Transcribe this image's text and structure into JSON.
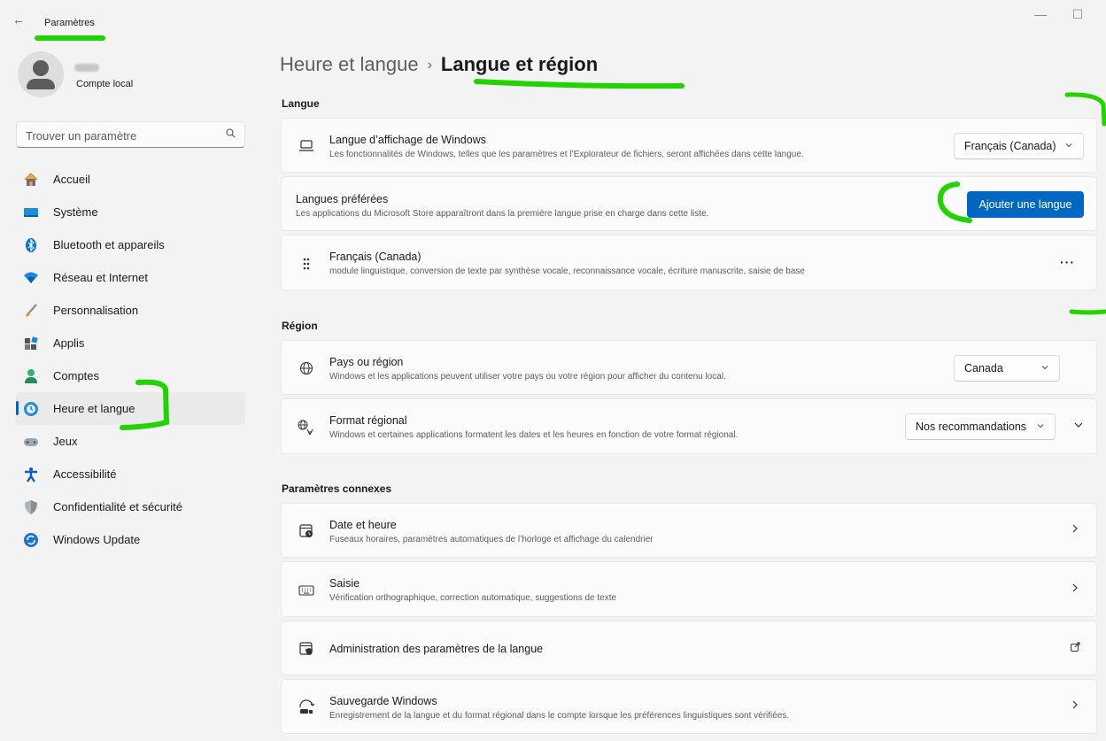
{
  "window": {
    "title": "Paramètres",
    "back_icon": "←",
    "minimize_icon": "—",
    "maximize_icon": "☐"
  },
  "profile": {
    "account_type": "Compte local"
  },
  "search": {
    "placeholder": "Trouver un paramètre"
  },
  "nav": {
    "items": [
      {
        "label": "Accueil",
        "icon": "home-icon"
      },
      {
        "label": "Système",
        "icon": "system-icon"
      },
      {
        "label": "Bluetooth et appareils",
        "icon": "bluetooth-icon"
      },
      {
        "label": "Réseau et Internet",
        "icon": "network-icon"
      },
      {
        "label": "Personnalisation",
        "icon": "brush-icon"
      },
      {
        "label": "Applis",
        "icon": "apps-icon"
      },
      {
        "label": "Comptes",
        "icon": "accounts-icon"
      },
      {
        "label": "Heure et langue",
        "icon": "time-language-icon",
        "selected": true
      },
      {
        "label": "Jeux",
        "icon": "gamepad-icon"
      },
      {
        "label": "Accessibilité",
        "icon": "accessibility-icon"
      },
      {
        "label": "Confidentialité et sécurité",
        "icon": "shield-icon"
      },
      {
        "label": "Windows Update",
        "icon": "update-icon"
      }
    ]
  },
  "breadcrumb": {
    "parent": "Heure et langue",
    "separator": "›",
    "current": "Langue et région"
  },
  "sections": {
    "langue": "Langue",
    "region": "Région",
    "related": "Paramètres connexes"
  },
  "display_language": {
    "title": "Langue d’affichage de Windows",
    "description": "Les fonctionnalités de Windows, telles que les paramètres et l’Explorateur de fichiers, seront affichées dans cette langue.",
    "value": "Français (Canada)"
  },
  "preferred_languages": {
    "title": "Langues préférées",
    "description": "Les applications du Microsoft Store apparaîtront dans la première langue prise en charge dans cette liste.",
    "button": "Ajouter une langue"
  },
  "installed_language": {
    "title": "Français (Canada)",
    "description": "module linguistique, conversion de texte par synthèse vocale, reconnaissance vocale, écriture manuscrite, saisie de base",
    "more": "···"
  },
  "country_region": {
    "title": "Pays ou région",
    "description": "Windows et les applications peuvent utiliser votre pays ou votre région pour afficher du contenu local.",
    "value": "Canada"
  },
  "regional_format": {
    "title": "Format régional",
    "description": "Windows et certaines applications formatent les dates et les heures en fonction de votre format régional.",
    "value": "Nos recommandations"
  },
  "related": [
    {
      "title": "Date et heure",
      "description": "Fuseaux horaires, paramètres automatiques de l’horloge et affichage du calendrier",
      "icon": "calendar-clock-icon"
    },
    {
      "title": "Saisie",
      "description": "Vérification orthographique, correction automatique, suggestions de texte",
      "icon": "keyboard-icon"
    },
    {
      "title": "Administration des paramètres de la langue",
      "description": "",
      "icon": "admin-language-icon"
    },
    {
      "title": "Sauvegarde Windows",
      "description": "Enregistrement de la langue et du format régional dans le compte lorsque les préférences linguistiques sont vérifiées.",
      "icon": "backup-icon"
    }
  ],
  "colors": {
    "accent": "#0067c0",
    "annotation": "#22d300"
  }
}
